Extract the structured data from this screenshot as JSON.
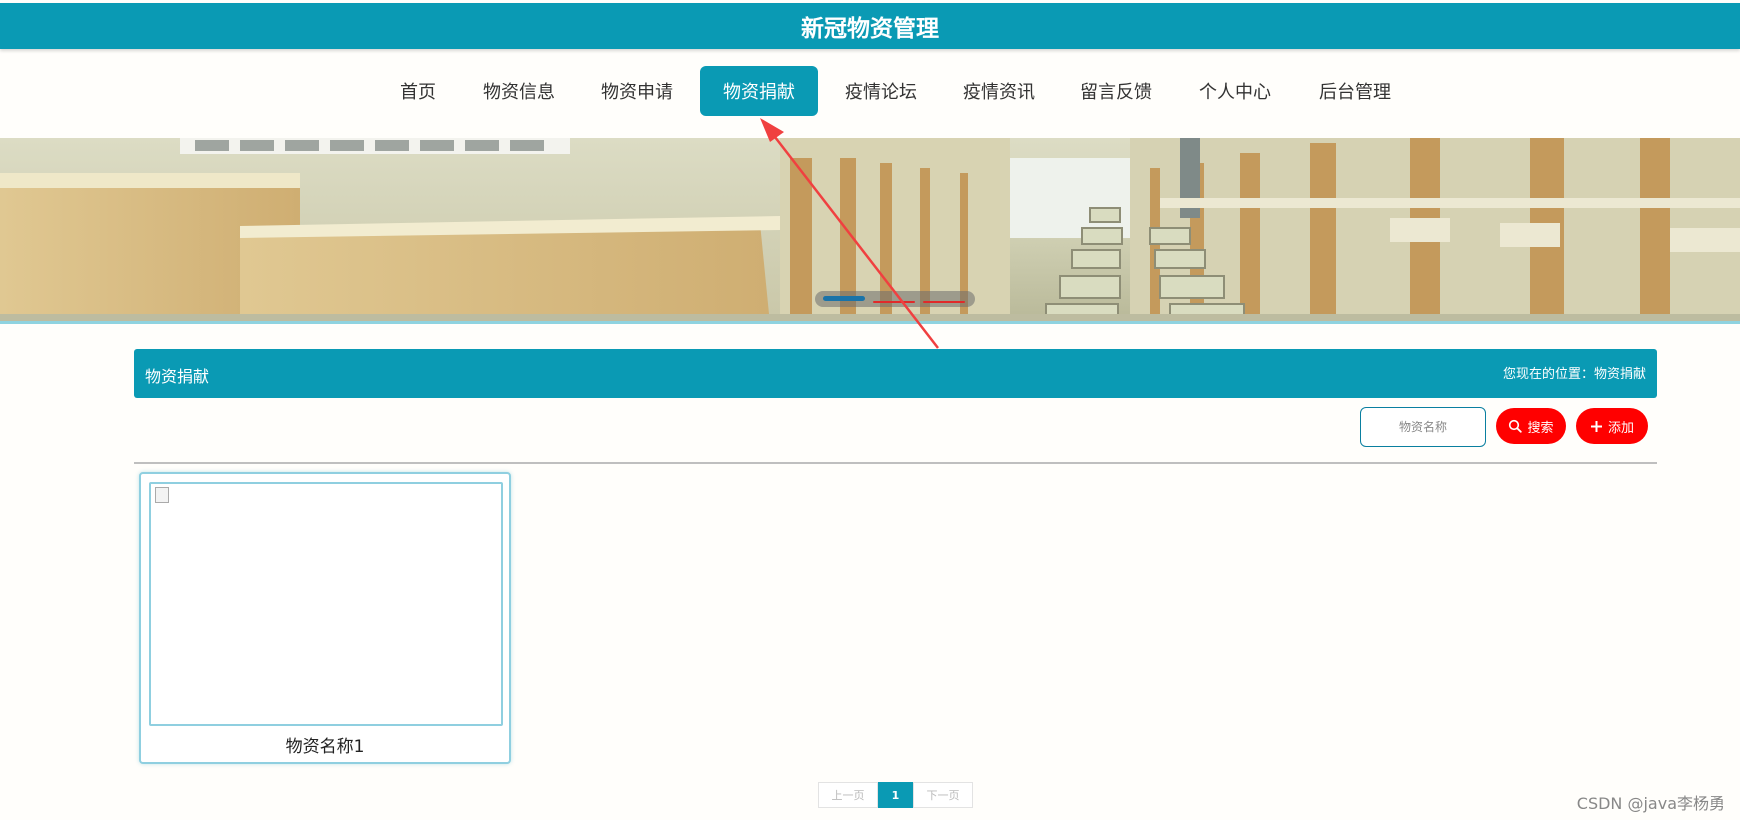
{
  "header": {
    "title": "新冠物资管理"
  },
  "nav": {
    "items": [
      {
        "label": "首页"
      },
      {
        "label": "物资信息"
      },
      {
        "label": "物资申请"
      },
      {
        "label": "物资捐献"
      },
      {
        "label": "疫情论坛"
      },
      {
        "label": "疫情资讯"
      },
      {
        "label": "留言反馈"
      },
      {
        "label": "个人中心"
      },
      {
        "label": "后台管理"
      }
    ],
    "active_index": 3
  },
  "section": {
    "title": "物资捐献",
    "breadcrumb": "您现在的位置：物资捐献"
  },
  "toolbar": {
    "search_placeholder": "物资名称",
    "search_label": "搜索",
    "search_icon": "search-icon",
    "add_label": "添加",
    "add_icon": "plus-icon"
  },
  "items": [
    {
      "name": "物资名称1"
    }
  ],
  "pagination": {
    "prev_label": "上一页",
    "current_page": "1",
    "next_label": "下一页"
  },
  "watermark": "CSDN @java李杨勇",
  "colors": {
    "primary": "#0a9ab4",
    "danger": "#ff0000",
    "annotation_arrow": "#f04040"
  }
}
